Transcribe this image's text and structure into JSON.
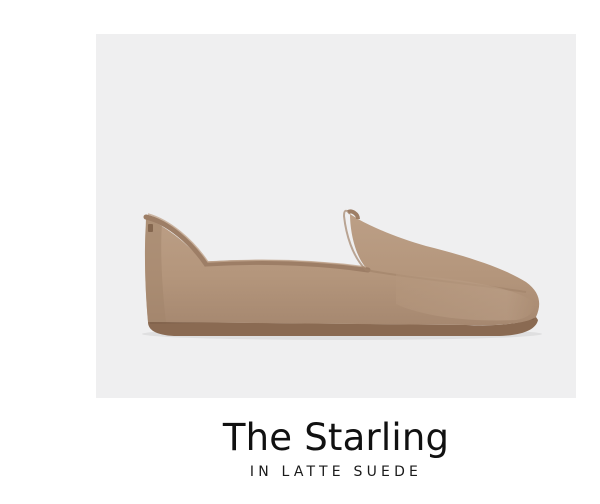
{
  "product": {
    "name": "The Starling",
    "variant": "IN LATTE SUEDE",
    "colors": {
      "background_panel": "#efeff0",
      "suede": "#b5977d",
      "suede_shadow": "#9c7f66",
      "lining": "#a8896f",
      "sole": "#8a6a52"
    },
    "image_subject": "shoe-image"
  }
}
